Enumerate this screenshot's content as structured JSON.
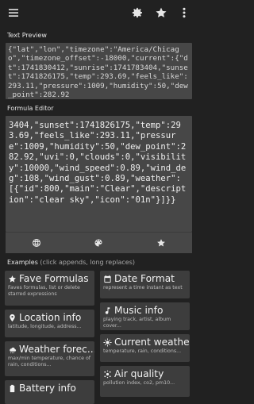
{
  "toolbar": {
    "menu_icon": "hamburger-menu-icon",
    "settings_icon": "gear-icon",
    "favorite_icon": "star-icon",
    "overflow_icon": "vertical-dots-icon"
  },
  "text_preview": {
    "label": "Text Preview",
    "content": "{\"lat\",\"lon\",\"timezone\":\"America/Chicago\",\"timezone_offset\":-18000,\"current\":{\"dt\":1741830412,\"sunrise\":1741783404,\"sunset\":1741826175,\"temp\":293.69,\"feels_like\":293.11,\"pressure\":1009,\"humidity\":50,\"dew_point\":282.92"
  },
  "formula_editor": {
    "label": "Formula Editor",
    "content": "3404,\"sunset\":1741826175,\"temp\":293.69,\"feels_like\":293.11,\"pressure\":1009,\"humidity\":50,\"dew_point\":282.92,\"uvi\":0,\"clouds\":0,\"visibility\":10000,\"wind_speed\":0.89,\"wind_deg\":108,\"wind_gust\":0.89,\"weather\":\n[{\"id\":800,\"main\":\"Clear\",\"description\":\"clear sky\",\"icon\":\"01n\"}]}}",
    "actions": [
      {
        "icon": "globe-icon"
      },
      {
        "icon": "palette-icon"
      },
      {
        "icon": "star-icon"
      }
    ]
  },
  "examples": {
    "label": "Examples",
    "hint": "(click appends, long replaces)",
    "items": [
      {
        "icon": "star-icon",
        "title": "Fave Formulas",
        "desc": "Faves formulas, list or delete starred expressions"
      },
      {
        "icon": "calendar-icon",
        "title": "Date Format",
        "desc": "represent a time instant as text"
      },
      {
        "icon": "location-pin-icon",
        "title": "Location info",
        "desc": "latitude, longitude, address..."
      },
      {
        "icon": "music-note-icon",
        "title": "Music info",
        "desc": "playing track, artist, album cover..."
      },
      {
        "icon": "weather-cloud-icon",
        "title": "Weather forec...",
        "desc": "max/min temperature, chance of rain, conditions..."
      },
      {
        "icon": "sun-icon",
        "title": "Current weather",
        "desc": "temperature, rain, conditions..."
      },
      {
        "icon": "battery-icon",
        "title": "Battery info",
        "desc": ""
      },
      {
        "icon": "air-quality-icon",
        "title": "Air quality",
        "desc": "pollution index, co2, pm10..."
      }
    ]
  }
}
